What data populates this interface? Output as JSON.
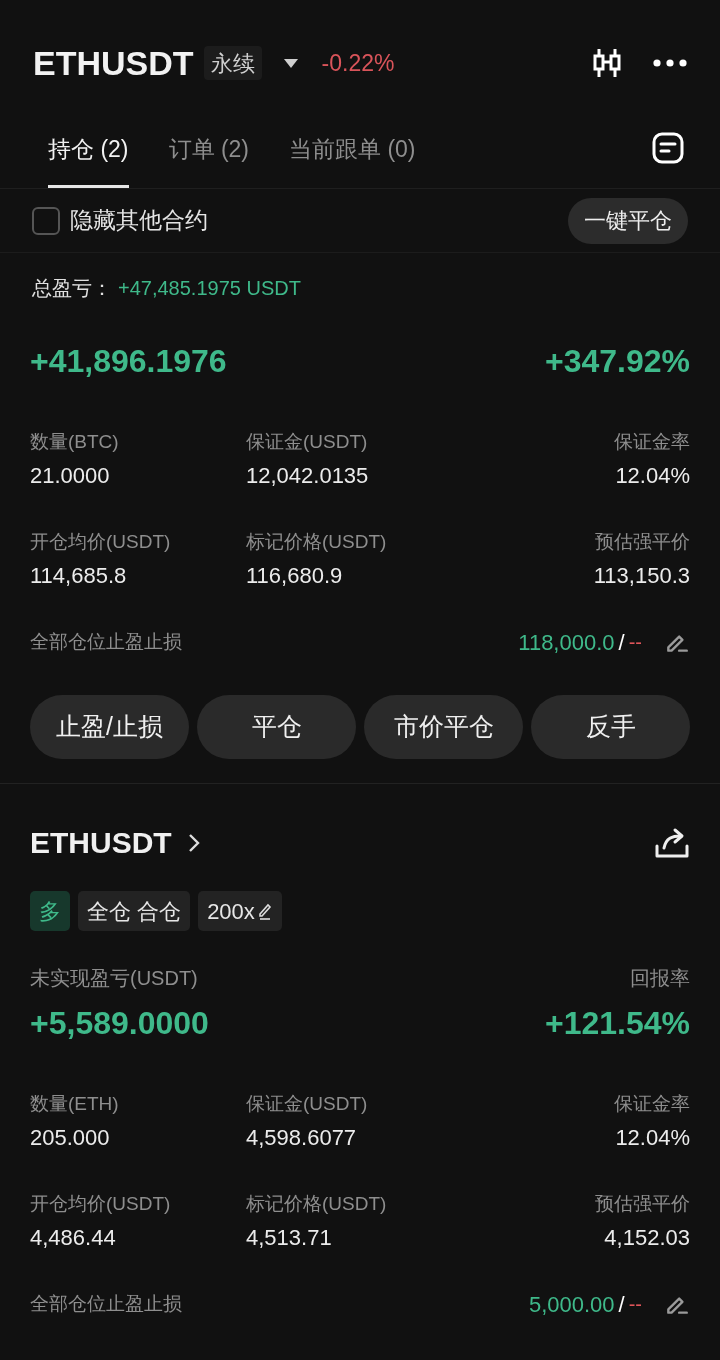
{
  "header": {
    "symbol": "ETHUSDT",
    "badge": "永续",
    "change": "-0.22%"
  },
  "tabs": [
    {
      "label": "持仓 (2)",
      "selected": true
    },
    {
      "label": "订单 (2)",
      "selected": false
    },
    {
      "label": "当前跟单 (0)",
      "selected": false
    }
  ],
  "hide_others": {
    "label": "隐藏其他合约",
    "checked": false
  },
  "close_all_button": "一键平仓",
  "total_pnl": {
    "label": "总盈亏：",
    "value": "+47,485.1975 USDT"
  },
  "positions": [
    {
      "pnl": "+41,896.1976",
      "roe": "+347.92%",
      "stats": [
        {
          "label": "数量(BTC)",
          "value": "21.0000"
        },
        {
          "label": "保证金(USDT)",
          "value": "12,042.0135"
        },
        {
          "label": "保证金率",
          "value": "12.04%"
        },
        {
          "label": "开仓均价(USDT)",
          "value": "114,685.8"
        },
        {
          "label": "标记价格(USDT)",
          "value": "116,680.9"
        },
        {
          "label": "预估强平价",
          "value": "113,150.3"
        }
      ],
      "tpsl": {
        "label": "全部仓位止盈止损",
        "take_profit": "118,000.0",
        "separator": "/",
        "stop_loss": "--"
      },
      "actions": [
        "止盈/止损",
        "平仓",
        "市价平仓",
        "反手"
      ]
    },
    {
      "symbol": "ETHUSDT",
      "tags": [
        {
          "kind": "side",
          "text": "多"
        },
        {
          "kind": "plain",
          "text": "全仓 合仓"
        },
        {
          "kind": "leverage",
          "text": "200x"
        }
      ],
      "pnl_label": "未实现盈亏(USDT)",
      "roe_label": "回报率",
      "pnl": "+5,589.0000",
      "roe": "+121.54%",
      "stats": [
        {
          "label": "数量(ETH)",
          "value": "205.000"
        },
        {
          "label": "保证金(USDT)",
          "value": "4,598.6077"
        },
        {
          "label": "保证金率",
          "value": "12.04%"
        },
        {
          "label": "开仓均价(USDT)",
          "value": "4,486.44"
        },
        {
          "label": "标记价格(USDT)",
          "value": "4,513.71"
        },
        {
          "label": "预估强平价",
          "value": "4,152.03"
        }
      ],
      "tpsl": {
        "label": "全部仓位止盈止损",
        "take_profit": "5,000.00",
        "separator": "/",
        "stop_loss": "--"
      }
    }
  ]
}
